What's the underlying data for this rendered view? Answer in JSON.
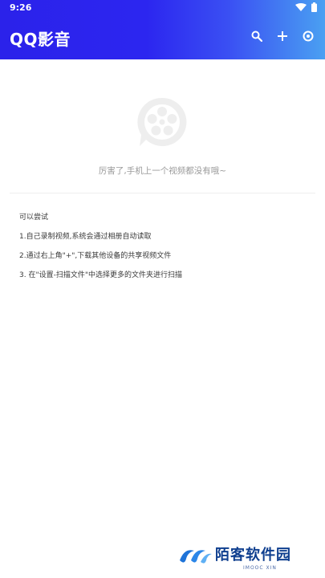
{
  "status_bar": {
    "time": "9:26"
  },
  "header": {
    "title": "QQ影音",
    "icons": [
      "search-icon",
      "add-icon",
      "settings-icon"
    ]
  },
  "empty_state": {
    "icon": "video-reel-icon",
    "message": "厉害了,手机上一个视频都没有哦~"
  },
  "tips": {
    "heading": "可以尝试",
    "items": [
      "1.自己录制视频,系统会通过相册自动读取",
      "2.通过右上角\"+\",下载其他设备的共享视频文件",
      "3. 在\"设置-扫描文件\"中选择更多的文件夹进行扫描"
    ]
  },
  "watermark": {
    "name": "陌客软件园",
    "sub": "IMOOC XIN"
  },
  "colors": {
    "header_start": "#2b22ea",
    "header_end": "#4aa0f2",
    "muted_text": "#9a9a9a",
    "body_text": "#3a3a3a"
  }
}
